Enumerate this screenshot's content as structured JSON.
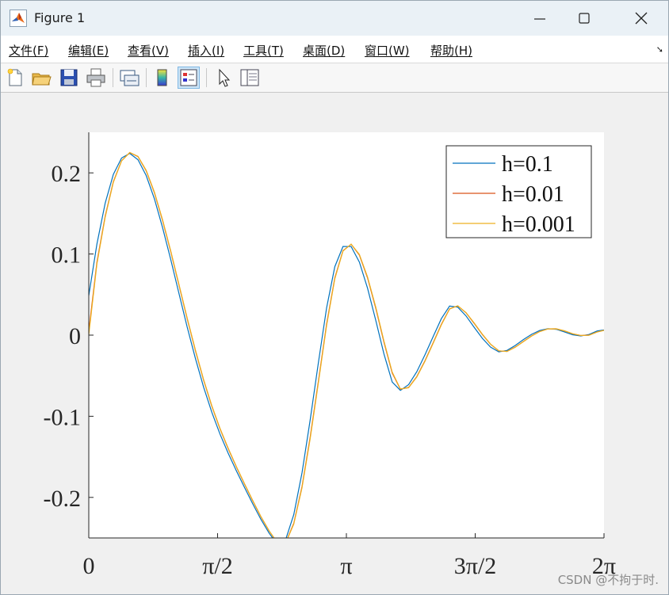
{
  "window": {
    "title": "Figure 1"
  },
  "menubar": {
    "items": [
      {
        "label": "文件(F)"
      },
      {
        "label": "编辑(E)"
      },
      {
        "label": "查看(V)"
      },
      {
        "label": "插入(I)"
      },
      {
        "label": "工具(T)"
      },
      {
        "label": "桌面(D)"
      },
      {
        "label": "窗口(W)"
      },
      {
        "label": "帮助(H)"
      }
    ]
  },
  "toolbar": {
    "buttons": [
      {
        "icon": "new-figure-icon"
      },
      {
        "icon": "open-file-icon"
      },
      {
        "icon": "save-icon"
      },
      {
        "icon": "print-icon"
      },
      {
        "icon": "link-icon"
      },
      {
        "icon": "colorbar-icon"
      },
      {
        "icon": "legend-icon",
        "active": true
      },
      {
        "icon": "pointer-icon"
      },
      {
        "icon": "property-inspector-icon"
      }
    ]
  },
  "watermark": "CSDN @不拘于时.",
  "chart_data": {
    "type": "line",
    "title": "",
    "xlabel": "",
    "ylabel": "",
    "xlim": [
      0,
      6.2832
    ],
    "ylim": [
      -0.25,
      0.25
    ],
    "xticks": [
      0,
      1.5708,
      3.1416,
      4.7124,
      6.2832
    ],
    "xtick_labels": [
      "0",
      "π/2",
      "π",
      "3π/2",
      "2π"
    ],
    "yticks": [
      -0.2,
      -0.1,
      0,
      0.1,
      0.2
    ],
    "ytick_labels": [
      "-0.2",
      "-0.1",
      "0",
      "0.1",
      "0.2"
    ],
    "grid": false,
    "legend_position": "top-right",
    "series": [
      {
        "name": "h=0.1",
        "color": "#0072bd",
        "x": [
          0,
          0.1,
          0.2,
          0.3,
          0.4,
          0.5,
          0.6,
          0.7,
          0.8,
          0.9,
          1.0,
          1.1,
          1.2,
          1.3,
          1.4,
          1.5,
          1.6,
          1.7,
          1.8,
          1.9,
          2.0,
          2.1,
          2.2,
          2.3,
          2.4,
          2.5,
          2.6,
          2.7,
          2.8,
          2.9,
          3.0,
          3.1,
          3.2,
          3.3,
          3.4,
          3.5,
          3.6,
          3.7,
          3.8,
          3.9,
          4.0,
          4.1,
          4.2,
          4.3,
          4.4,
          4.5,
          4.6,
          4.7,
          4.8,
          4.9,
          5.0,
          5.1,
          5.2,
          5.3,
          5.4,
          5.5,
          5.6,
          5.7,
          5.8,
          5.9,
          6.0,
          6.1,
          6.2,
          6.2832
        ],
        "y": [
          0.0487,
          0.1124,
          0.1627,
          0.1981,
          0.2184,
          0.224,
          0.2162,
          0.1968,
          0.1681,
          0.1325,
          0.0928,
          0.0513,
          0.0102,
          -0.0286,
          -0.0639,
          -0.095,
          -0.1219,
          -0.1456,
          -0.1673,
          -0.188,
          -0.208,
          -0.2271,
          -0.2442,
          -0.2576,
          -0.2522,
          -0.2213,
          -0.1698,
          -0.1046,
          -0.0338,
          0.0334,
          0.0844,
          0.1093,
          0.1092,
          0.09,
          0.0578,
          0.0181,
          -0.0232,
          -0.0578,
          -0.0681,
          -0.061,
          -0.0451,
          -0.0243,
          -0.0018,
          0.0203,
          0.0358,
          0.0345,
          0.0237,
          0.0097,
          -0.004,
          -0.0148,
          -0.0206,
          -0.0188,
          -0.0128,
          -0.0055,
          0.001,
          0.0058,
          0.008,
          0.0072,
          0.004,
          0.0005,
          -0.001,
          0.0008,
          0.0052,
          0.0063
        ]
      },
      {
        "name": "h=0.01",
        "color": "#d95319",
        "x": [
          0,
          0.1,
          0.2,
          0.3,
          0.4,
          0.5,
          0.6,
          0.7,
          0.8,
          0.9,
          1.0,
          1.1,
          1.2,
          1.3,
          1.4,
          1.5,
          1.6,
          1.7,
          1.8,
          1.9,
          2.0,
          2.1,
          2.2,
          2.3,
          2.4,
          2.5,
          2.6,
          2.7,
          2.8,
          2.9,
          3.0,
          3.1,
          3.2,
          3.3,
          3.4,
          3.5,
          3.6,
          3.7,
          3.8,
          3.9,
          4.0,
          4.1,
          4.2,
          4.3,
          4.4,
          4.5,
          4.6,
          4.7,
          4.8,
          4.9,
          5.0,
          5.1,
          5.2,
          5.3,
          5.4,
          5.5,
          5.6,
          5.7,
          5.8,
          5.9,
          6.0,
          6.1,
          6.2,
          6.2832
        ],
        "y": [
          0.0049,
          0.0901,
          0.1468,
          0.1893,
          0.215,
          0.225,
          0.22,
          0.2025,
          0.1755,
          0.1413,
          0.1025,
          0.0615,
          0.0204,
          -0.019,
          -0.0553,
          -0.0876,
          -0.1154,
          -0.14,
          -0.1625,
          -0.1838,
          -0.2043,
          -0.2239,
          -0.2415,
          -0.2558,
          -0.256,
          -0.232,
          -0.1867,
          -0.1257,
          -0.0565,
          0.0135,
          0.0707,
          0.1042,
          0.112,
          0.0986,
          0.0705,
          0.033,
          -0.0088,
          -0.0467,
          -0.0666,
          -0.0645,
          -0.0511,
          -0.0316,
          -0.0093,
          0.0133,
          0.0325,
          0.036,
          0.0275,
          0.0145,
          0.0006,
          -0.0113,
          -0.0194,
          -0.02,
          -0.0148,
          -0.0078,
          -0.001,
          0.0045,
          0.0077,
          0.0078,
          0.0052,
          0.0017,
          -0.0005,
          0.0,
          0.004,
          0.006
        ]
      },
      {
        "name": "h=0.001",
        "color": "#edb120",
        "x": [
          0,
          0.1,
          0.2,
          0.3,
          0.4,
          0.5,
          0.6,
          0.7,
          0.8,
          0.9,
          1.0,
          1.1,
          1.2,
          1.3,
          1.4,
          1.5,
          1.6,
          1.7,
          1.8,
          1.9,
          2.0,
          2.1,
          2.2,
          2.3,
          2.4,
          2.5,
          2.6,
          2.7,
          2.8,
          2.9,
          3.0,
          3.1,
          3.2,
          3.3,
          3.4,
          3.5,
          3.6,
          3.7,
          3.8,
          3.9,
          4.0,
          4.1,
          4.2,
          4.3,
          4.4,
          4.5,
          4.6,
          4.7,
          4.8,
          4.9,
          5.0,
          5.1,
          5.2,
          5.3,
          5.4,
          5.5,
          5.6,
          5.7,
          5.8,
          5.9,
          6.0,
          6.1,
          6.2,
          6.2832
        ],
        "y": [
          0.0005,
          0.0879,
          0.1452,
          0.1884,
          0.2147,
          0.2251,
          0.2204,
          0.2032,
          0.1763,
          0.1422,
          0.1035,
          0.0625,
          0.0214,
          -0.0181,
          -0.0545,
          -0.0868,
          -0.1147,
          -0.1394,
          -0.162,
          -0.1834,
          -0.2039,
          -0.2236,
          -0.2413,
          -0.2557,
          -0.2563,
          -0.233,
          -0.1883,
          -0.1278,
          -0.0587,
          0.0115,
          0.0693,
          0.1036,
          0.1122,
          0.0994,
          0.0717,
          0.0345,
          -0.0073,
          -0.0455,
          -0.0663,
          -0.0648,
          -0.0517,
          -0.0323,
          -0.0101,
          0.0126,
          0.0321,
          0.0361,
          0.0278,
          0.015,
          0.0011,
          -0.011,
          -0.0193,
          -0.0201,
          -0.015,
          -0.008,
          -0.0012,
          0.0044,
          0.0077,
          0.0078,
          0.0054,
          0.0018,
          -0.0004,
          -0.0002,
          0.0038,
          0.0059
        ]
      }
    ]
  }
}
